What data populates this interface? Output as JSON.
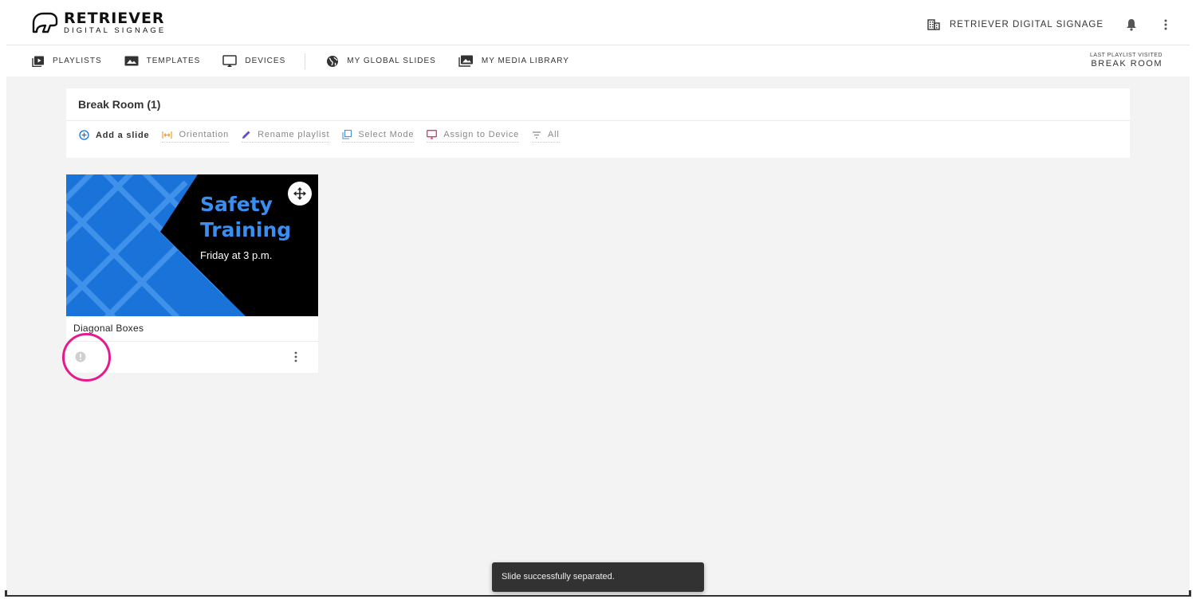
{
  "brand": {
    "name": "RETRIEVER",
    "subtitle": "DIGITAL SIGNAGE"
  },
  "header": {
    "organization": "RETRIEVER DIGITAL SIGNAGE"
  },
  "nav": {
    "items": [
      {
        "label": "PLAYLISTS",
        "icon": "playlist-icon"
      },
      {
        "label": "TEMPLATES",
        "icon": "image-icon"
      },
      {
        "label": "DEVICES",
        "icon": "monitor-icon"
      },
      {
        "label": "MY GLOBAL SLIDES",
        "icon": "globe-icon"
      },
      {
        "label": "MY MEDIA LIBRARY",
        "icon": "media-library-icon"
      }
    ],
    "last_visited_label": "LAST PLAYLIST VISITED",
    "last_visited_value": "BREAK ROOM"
  },
  "playlist": {
    "title": "Break Room (1)",
    "actions": [
      {
        "label": "Add a slide",
        "icon": "add-circle-icon"
      },
      {
        "label": "Orientation",
        "icon": "orientation-icon"
      },
      {
        "label": "Rename playlist",
        "icon": "pencil-icon"
      },
      {
        "label": "Select Mode",
        "icon": "select-mode-icon"
      },
      {
        "label": "Assign to Device",
        "icon": "cast-icon"
      },
      {
        "label": "All",
        "icon": "filter-icon"
      }
    ]
  },
  "slide": {
    "headline_line1": "Safety",
    "headline_line2": "Training",
    "subline": "Friday at 3 p.m.",
    "name": "Diagonal Boxes"
  },
  "snackbar": {
    "message": "Slide successfully separated."
  },
  "colors": {
    "slide_blue": "#1a73d9",
    "slide_text_blue": "#3a8ef0",
    "highlight": "#e41b8f",
    "orientation": "#f0a030",
    "assign": "#e0306a",
    "add": "#1a73d9"
  }
}
